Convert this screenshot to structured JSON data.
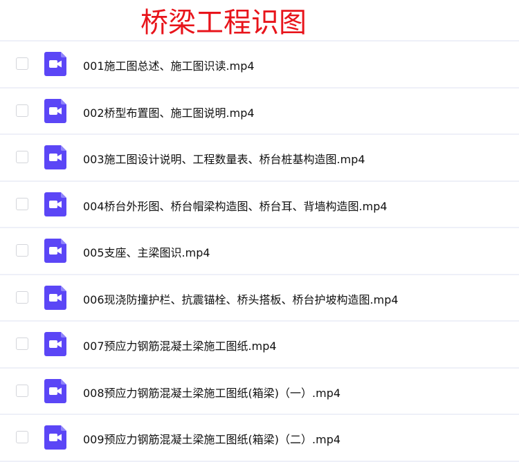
{
  "title": "桥梁工程识图",
  "colors": {
    "title": "#e8141b",
    "icon": "#5b46f6"
  },
  "files": [
    {
      "name": "001施工图总述、施工图识读.mp4"
    },
    {
      "name": "002桥型布置图、施工图说明.mp4"
    },
    {
      "name": "003施工图设计说明、工程数量表、桥台桩基构造图.mp4"
    },
    {
      "name": "004桥台外形图、桥台帽梁构造图、桥台耳、背墙构造图.mp4"
    },
    {
      "name": "005支座、主梁图识.mp4"
    },
    {
      "name": "006现浇防撞护栏、抗震锚栓、桥头搭板、桥台护坡构造图.mp4"
    },
    {
      "name": "007预应力钢筋混凝土梁施工图纸.mp4"
    },
    {
      "name": "008预应力钢筋混凝土梁施工图纸(箱梁)（一）.mp4"
    },
    {
      "name": "009预应力钢筋混凝土梁施工图纸(箱梁)（二）.mp4"
    }
  ]
}
